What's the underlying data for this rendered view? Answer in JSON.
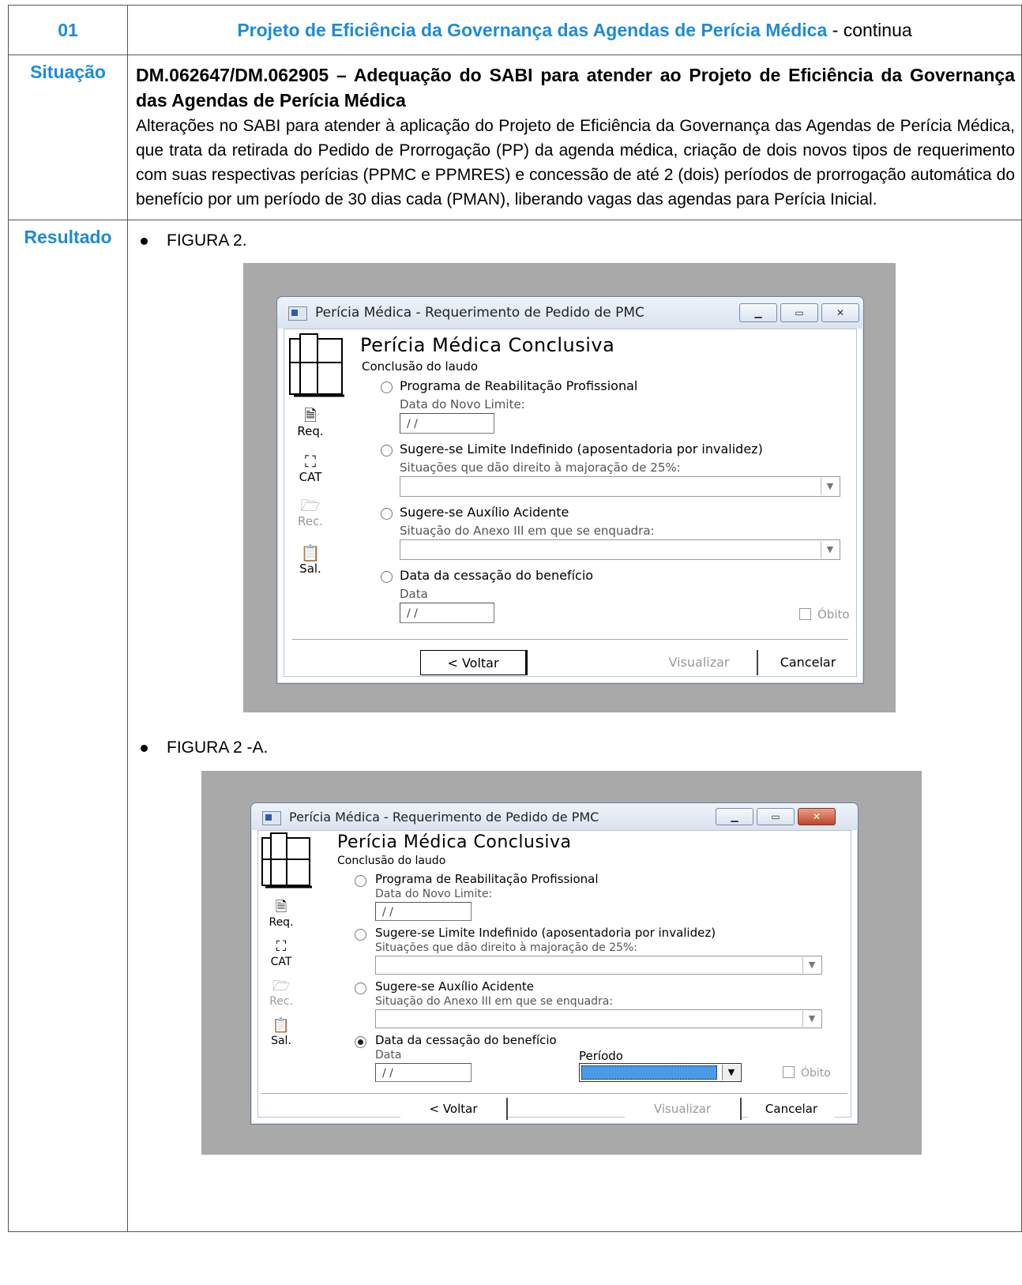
{
  "header": {
    "number": "01",
    "project_title": "Projeto de Eficiência da Governança das Agendas de Perícia Médica",
    "suffix": " - continua"
  },
  "situacao": {
    "label": "Situação",
    "heading": "DM.062647/DM.062905 – Adequação do SABI para atender ao Projeto de Eficiência da Governança das Agendas de Perícia Médica",
    "body": "Alterações no SABI para atender à aplicação do Projeto de Eficiência da Governança das Agendas de Perícia Médica, que trata da retirada do Pedido de Prorrogação (PP) da agenda médica, criação de dois novos tipos de requerimento com suas respectivas perícias (PPMC e PPMRES) e concessão de até 2 (dois) períodos de prorrogação automática do benefício por um período de 30 dias cada (PMAN), liberando vagas das agendas para Perícia Inicial."
  },
  "resultado": {
    "label": "Resultado",
    "figures": [
      {
        "caption": "FIGURA 2.",
        "window": {
          "title": "Perícia Médica - Requerimento de Pedido de PMC",
          "heading": "Perícia Médica Conclusiva",
          "subheading": "Conclusão do laudo",
          "side_icons": [
            {
              "label": "Req.",
              "icon": "requerimento-icon"
            },
            {
              "label": "CAT",
              "icon": "cat-icon"
            },
            {
              "label": "Rec.",
              "icon": "folder-icon"
            },
            {
              "label": "Sal.",
              "icon": "clipboard-icon"
            }
          ],
          "options": [
            {
              "label": "Programa de Reabilitação Profissional",
              "hint": "Data do Novo Limite:",
              "field_value": "/ /",
              "selected": false
            },
            {
              "label": "Sugere-se Limite Indefinido (aposentadoria por invalidez)",
              "hint": "Situações que dão direito à majoração de 25%:",
              "selected": false
            },
            {
              "label": "Sugere-se Auxílio Acidente",
              "hint": "Situação do Anexo III em que se enquadra:",
              "selected": false
            },
            {
              "label": "Data da cessação do benefício",
              "hint": "Data",
              "field_value": "/ /",
              "selected": false
            }
          ],
          "obito_label": "Óbito",
          "buttons": {
            "back": "< Voltar",
            "view": "Visualizar",
            "cancel": "Cancelar"
          }
        }
      },
      {
        "caption": "FIGURA 2 -A.",
        "window": {
          "title": "Perícia Médica - Requerimento de Pedido de PMC",
          "heading": "Perícia Médica Conclusiva",
          "subheading": "Conclusão do laudo",
          "side_icons": [
            {
              "label": "Req.",
              "icon": "requerimento-icon"
            },
            {
              "label": "CAT",
              "icon": "cat-icon"
            },
            {
              "label": "Rec.",
              "icon": "folder-icon"
            },
            {
              "label": "Sal.",
              "icon": "clipboard-icon"
            }
          ],
          "options": [
            {
              "label": "Programa de Reabilitação Profissional",
              "hint": "Data do Novo Limite:",
              "field_value": "/ /",
              "selected": false
            },
            {
              "label": "Sugere-se Limite Indefinido (aposentadoria por invalidez)",
              "hint": "Situações que dão direito à majoração de 25%:",
              "selected": false
            },
            {
              "label": "Sugere-se Auxílio Acidente",
              "hint": "Situação do Anexo III em que se enquadra:",
              "selected": false
            },
            {
              "label": "Data da cessação do benefício",
              "hint": "Data",
              "field_value": "/ /",
              "selected": true
            }
          ],
          "periodo_label": "Período",
          "obito_label": "Óbito",
          "buttons": {
            "back": "< Voltar",
            "view": "Visualizar",
            "cancel": "Cancelar"
          }
        }
      }
    ]
  }
}
